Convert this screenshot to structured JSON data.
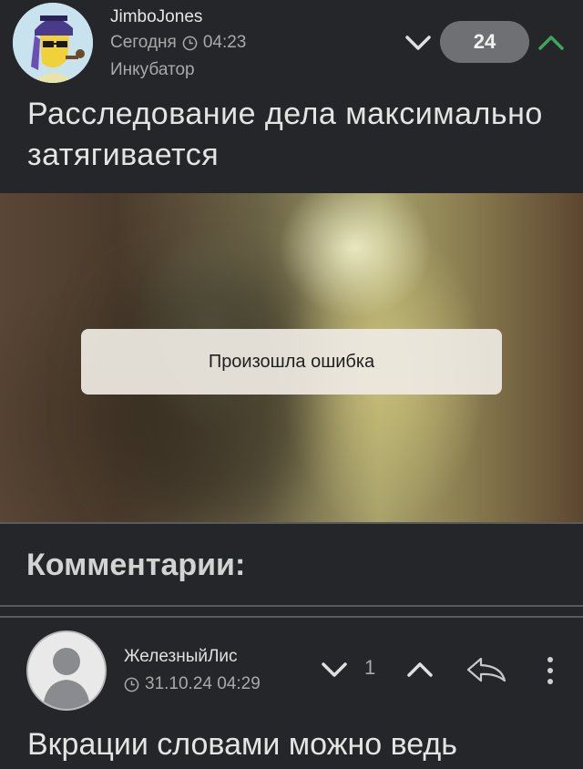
{
  "post": {
    "author": "JimboJones",
    "date": "Сегодня",
    "time": "04:23",
    "community": "Инкубатор",
    "rating": "24",
    "title": "Расследование дела максимально затягивается"
  },
  "video": {
    "error_message": "Произошла ошибка"
  },
  "comments": {
    "heading": "Комментарии:",
    "items": [
      {
        "author": "ЖелезныйЛис",
        "datetime": "31.10.24 04:29",
        "rating": "1",
        "text": "Вкрации словами можно ведь"
      }
    ]
  },
  "colors": {
    "background": "#252629",
    "rating_badge": "#6f7074",
    "upvote": "#3fa55b"
  },
  "icons": [
    "clock-icon",
    "chevron-down-icon",
    "chevron-up-icon",
    "reply-icon",
    "more-vertical-icon",
    "user-avatar-icon"
  ]
}
